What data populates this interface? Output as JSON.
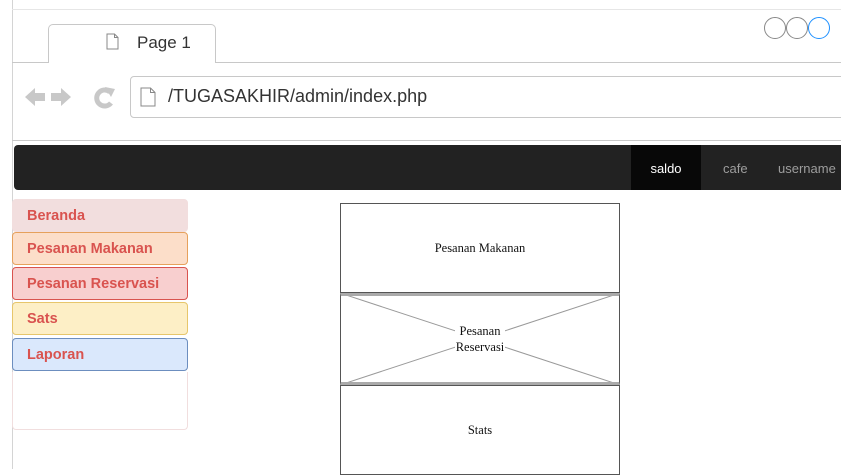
{
  "browser": {
    "tab_title": "Page 1",
    "url": "/TUGASAKHIR/admin/index.php",
    "icons": [
      "back-arrow-icon",
      "forward-arrow-icon",
      "reload-icon",
      "document-icon"
    ],
    "window_circle_colors": [
      "#888888",
      "#888888",
      "#1e90ff"
    ]
  },
  "navbar": {
    "links": [
      {
        "label": "saldo",
        "active": true
      },
      {
        "label": "cafe",
        "active": false
      },
      {
        "label": "username",
        "active": false
      }
    ]
  },
  "sidebar": {
    "items": [
      {
        "label": "Beranda",
        "color": "#f2dede"
      },
      {
        "label": "Pesanan Makanan",
        "color": "#fcdec9"
      },
      {
        "label": "Pesanan Reservasi",
        "color": "#f8cfcf"
      },
      {
        "label": "Sats",
        "color": "#fdefc6"
      },
      {
        "label": "Laporan",
        "color": "#dae8fc"
      }
    ],
    "text_color": "#d9534f"
  },
  "main": {
    "boxes": [
      {
        "label": "Pesanan Makanan"
      },
      {
        "label_line1": "Pesanan",
        "label_line2": "Reservasi"
      },
      {
        "label": "Stats"
      }
    ]
  }
}
